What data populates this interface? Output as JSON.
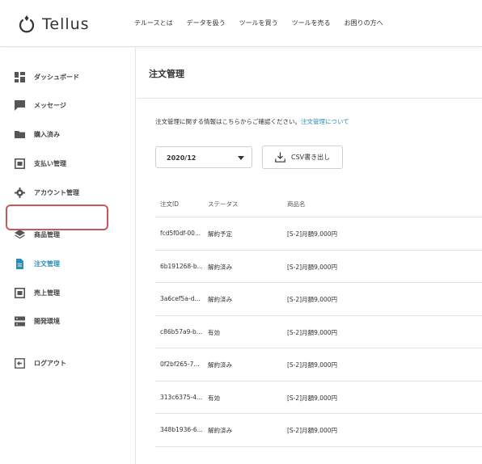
{
  "header": {
    "logo_text": "Tellus",
    "nav": [
      "テルースとは",
      "データを扱う",
      "ツールを買う",
      "ツールを売る",
      "お困りの方へ"
    ]
  },
  "sidebar": {
    "items": [
      {
        "label": "ダッシュボード",
        "icon": "dashboard-icon"
      },
      {
        "label": "メッセージ",
        "icon": "message-icon"
      },
      {
        "label": "購入済み",
        "icon": "folder-icon"
      },
      {
        "label": "支払い管理",
        "icon": "payment-icon"
      },
      {
        "label": "アカウント管理",
        "icon": "gear-icon"
      },
      {
        "label": "商品管理",
        "icon": "layers-icon"
      },
      {
        "label": "注文管理",
        "icon": "document-icon",
        "active": true
      },
      {
        "label": "売上管理",
        "icon": "sales-icon"
      },
      {
        "label": "開発環境",
        "icon": "server-icon"
      },
      {
        "label": "ログアウト",
        "icon": "logout-icon"
      }
    ]
  },
  "main": {
    "title": "注文管理",
    "info_text": "注文管理に関する情報はこちらからご確認ください。",
    "info_link": "注文管理について",
    "month_value": "2020/12",
    "csv_label": "CSV書き出し",
    "table": {
      "headers": [
        "注文ID",
        "ステータス",
        "商品名"
      ],
      "rows": [
        [
          "fcd5f0df-00...",
          "解約予定",
          "[S-2]月額9,000円"
        ],
        [
          "6b191268-b...",
          "解約済み",
          "[S-2]月額9,000円"
        ],
        [
          "3a6cef5a-d...",
          "解約済み",
          "[S-2]月額9,000円"
        ],
        [
          "c86b57a9-b...",
          "有効",
          "[S-2]月額9,000円"
        ],
        [
          "0f2bf265-7...",
          "解約済み",
          "[S-2]月額9,000円"
        ],
        [
          "313c6375-4...",
          "有効",
          "[S-2]月額9,000円"
        ],
        [
          "348b1936-6...",
          "解約済み",
          "[S-2]月額9,000円"
        ]
      ]
    }
  },
  "colors": {
    "accent": "#2a8fb8",
    "highlight": "#c9575a"
  }
}
